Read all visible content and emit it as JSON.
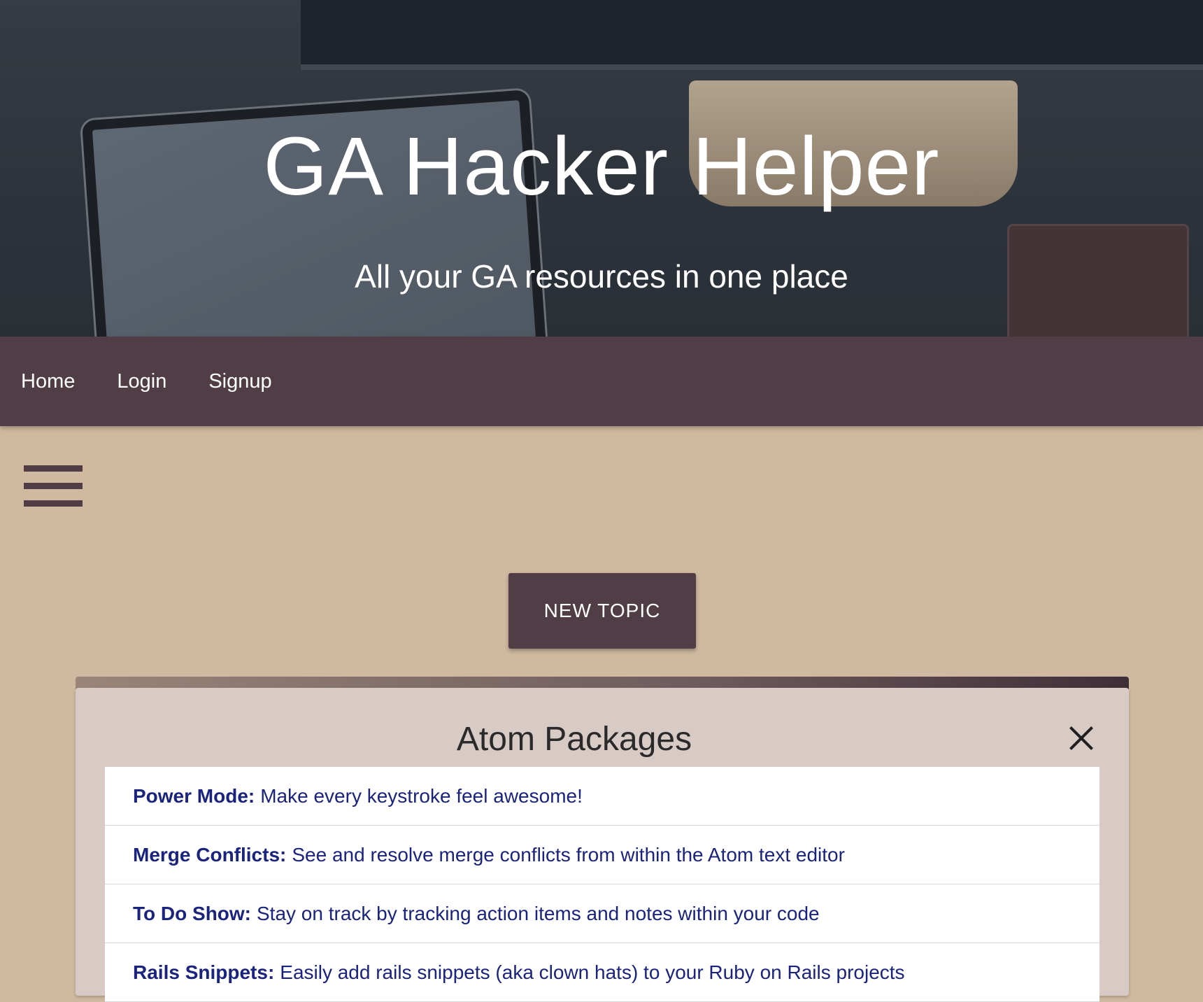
{
  "hero": {
    "title": "GA Hacker Helper",
    "subtitle": "All your GA resources in one place"
  },
  "nav": {
    "items": [
      {
        "label": "Home"
      },
      {
        "label": "Login"
      },
      {
        "label": "Signup"
      }
    ]
  },
  "main": {
    "new_topic_label": "NEW TOPIC"
  },
  "card": {
    "title": "Atom Packages",
    "items": [
      {
        "name": "Power Mode:",
        "description": "Make every keystroke feel awesome!"
      },
      {
        "name": "Merge Conflicts:",
        "description": "See and resolve merge conflicts from within the Atom text editor"
      },
      {
        "name": "To Do Show:",
        "description": "Stay on track by tracking action items and notes within your code"
      },
      {
        "name": "Rails Snippets:",
        "description": "Easily add rails snippets (aka clown hats) to your Ruby on Rails projects"
      }
    ]
  },
  "colors": {
    "nav_bg": "#513d45",
    "page_bg": "#cfb9a0",
    "link_text": "#1a237e"
  }
}
